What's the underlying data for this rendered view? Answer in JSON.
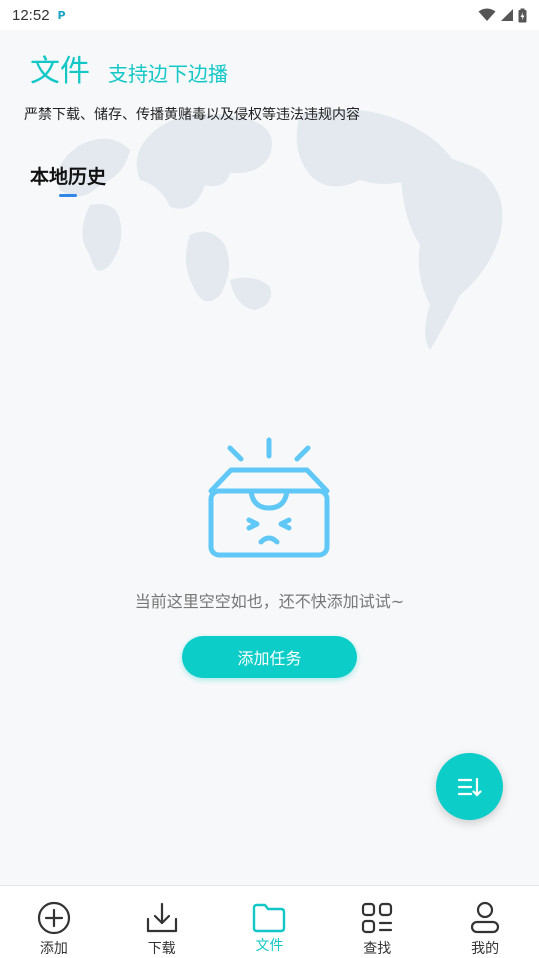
{
  "status_bar": {
    "time": "12:52",
    "app_icon": "P"
  },
  "header": {
    "title": "文件",
    "subtitle": "支持边下边播"
  },
  "notice": "严禁下载、储存、传播黄赌毒以及侵权等违法违规内容",
  "tabs": [
    {
      "label": "本地历史",
      "active": true
    }
  ],
  "empty_state": {
    "message": "当前这里空空如也，还不快添加试试~",
    "button_label": "添加任务"
  },
  "fab": {
    "icon": "sort-list-icon"
  },
  "bottom_nav": {
    "items": [
      {
        "label": "添加",
        "icon": "add-circle-icon",
        "active": false
      },
      {
        "label": "下载",
        "icon": "download-icon",
        "active": false
      },
      {
        "label": "文件",
        "icon": "folder-icon",
        "active": true
      },
      {
        "label": "查找",
        "icon": "apps-grid-icon",
        "active": false
      },
      {
        "label": "我的",
        "icon": "user-icon",
        "active": false
      }
    ]
  },
  "colors": {
    "accent": "#13c7c7",
    "button": "#0dcdc9",
    "tab_indicator": "#2f86e6",
    "illustration": "#5fc8f6"
  }
}
